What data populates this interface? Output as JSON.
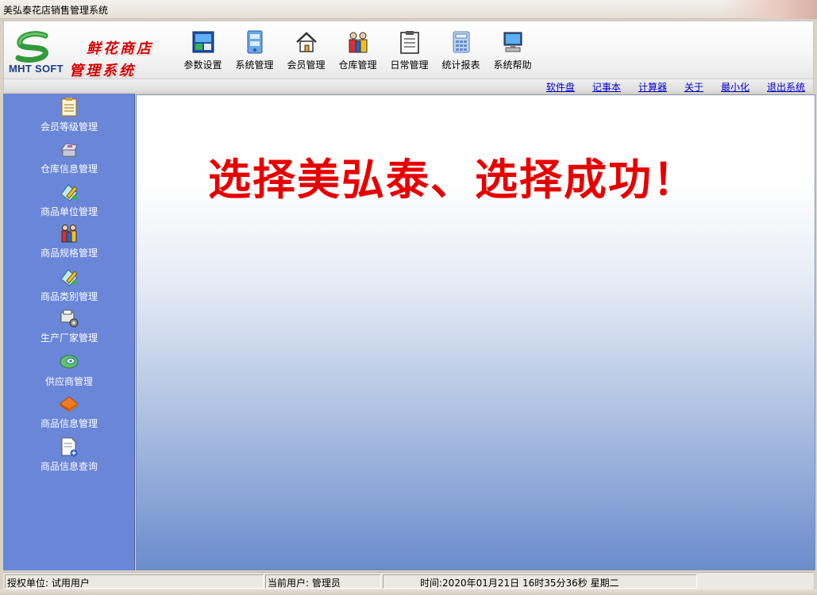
{
  "window": {
    "title": "美弘泰花店销售管理系统"
  },
  "logo": {
    "brand": "MHT SOFT",
    "line1": "鲜花商店",
    "line2": "管理系统"
  },
  "toolbar": {
    "items": [
      {
        "label": "参数设置",
        "icon": "settings-icon"
      },
      {
        "label": "系统管理",
        "icon": "cabinet-icon"
      },
      {
        "label": "会员管理",
        "icon": "house-icon"
      },
      {
        "label": "仓库管理",
        "icon": "people-icon"
      },
      {
        "label": "日常管理",
        "icon": "clipboard-icon"
      },
      {
        "label": "统计报表",
        "icon": "calculator-icon"
      },
      {
        "label": "系统帮助",
        "icon": "computer-icon"
      }
    ]
  },
  "links": [
    "软件盘",
    "记事本",
    "计算器",
    "关于",
    "最小化",
    "退出系统"
  ],
  "sidebar": {
    "items": [
      {
        "label": "会员等级管理",
        "icon": "clipboard-icon"
      },
      {
        "label": "仓库信息管理",
        "icon": "cash-register-icon"
      },
      {
        "label": "商品单位管理",
        "icon": "pen-paper-icon"
      },
      {
        "label": "商品规格管理",
        "icon": "people-icon"
      },
      {
        "label": "商品类别管理",
        "icon": "pen-paper-icon"
      },
      {
        "label": "生产厂家管理",
        "icon": "printer-gear-icon"
      },
      {
        "label": "供应商管理",
        "icon": "disc-icon"
      },
      {
        "label": "商品信息管理",
        "icon": "diamond-icon"
      },
      {
        "label": "商品信息查询",
        "icon": "document-add-icon"
      }
    ]
  },
  "main": {
    "slogan": "选择美弘泰、选择成功！"
  },
  "status": {
    "unit_label": "授权单位:",
    "unit_value": "试用用户",
    "user_label": "当前用户:",
    "user_value": "管理员",
    "time_label": "时间:",
    "time_value": "2020年01月21日 16时35分36秒 星期二"
  },
  "colors": {
    "sidebar_bg": "#6a86d9",
    "slogan": "#e60000",
    "link": "#0000cc"
  }
}
